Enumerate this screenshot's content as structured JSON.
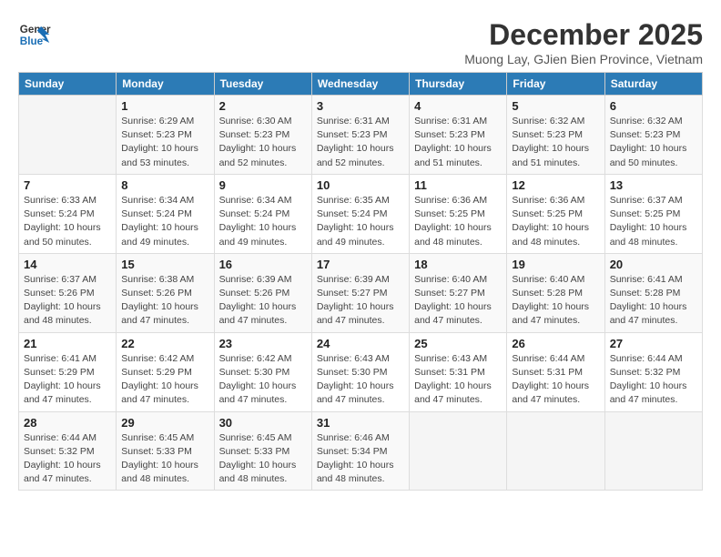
{
  "header": {
    "logo_line1": "General",
    "logo_line2": "Blue",
    "title": "December 2025",
    "subtitle": "Muong Lay, GJien Bien Province, Vietnam"
  },
  "days_of_week": [
    "Sunday",
    "Monday",
    "Tuesday",
    "Wednesday",
    "Thursday",
    "Friday",
    "Saturday"
  ],
  "weeks": [
    [
      {
        "day": "",
        "info": ""
      },
      {
        "day": "1",
        "info": "Sunrise: 6:29 AM\nSunset: 5:23 PM\nDaylight: 10 hours\nand 53 minutes."
      },
      {
        "day": "2",
        "info": "Sunrise: 6:30 AM\nSunset: 5:23 PM\nDaylight: 10 hours\nand 52 minutes."
      },
      {
        "day": "3",
        "info": "Sunrise: 6:31 AM\nSunset: 5:23 PM\nDaylight: 10 hours\nand 52 minutes."
      },
      {
        "day": "4",
        "info": "Sunrise: 6:31 AM\nSunset: 5:23 PM\nDaylight: 10 hours\nand 51 minutes."
      },
      {
        "day": "5",
        "info": "Sunrise: 6:32 AM\nSunset: 5:23 PM\nDaylight: 10 hours\nand 51 minutes."
      },
      {
        "day": "6",
        "info": "Sunrise: 6:32 AM\nSunset: 5:23 PM\nDaylight: 10 hours\nand 50 minutes."
      }
    ],
    [
      {
        "day": "7",
        "info": "Sunrise: 6:33 AM\nSunset: 5:24 PM\nDaylight: 10 hours\nand 50 minutes."
      },
      {
        "day": "8",
        "info": "Sunrise: 6:34 AM\nSunset: 5:24 PM\nDaylight: 10 hours\nand 49 minutes."
      },
      {
        "day": "9",
        "info": "Sunrise: 6:34 AM\nSunset: 5:24 PM\nDaylight: 10 hours\nand 49 minutes."
      },
      {
        "day": "10",
        "info": "Sunrise: 6:35 AM\nSunset: 5:24 PM\nDaylight: 10 hours\nand 49 minutes."
      },
      {
        "day": "11",
        "info": "Sunrise: 6:36 AM\nSunset: 5:25 PM\nDaylight: 10 hours\nand 48 minutes."
      },
      {
        "day": "12",
        "info": "Sunrise: 6:36 AM\nSunset: 5:25 PM\nDaylight: 10 hours\nand 48 minutes."
      },
      {
        "day": "13",
        "info": "Sunrise: 6:37 AM\nSunset: 5:25 PM\nDaylight: 10 hours\nand 48 minutes."
      }
    ],
    [
      {
        "day": "14",
        "info": "Sunrise: 6:37 AM\nSunset: 5:26 PM\nDaylight: 10 hours\nand 48 minutes."
      },
      {
        "day": "15",
        "info": "Sunrise: 6:38 AM\nSunset: 5:26 PM\nDaylight: 10 hours\nand 47 minutes."
      },
      {
        "day": "16",
        "info": "Sunrise: 6:39 AM\nSunset: 5:26 PM\nDaylight: 10 hours\nand 47 minutes."
      },
      {
        "day": "17",
        "info": "Sunrise: 6:39 AM\nSunset: 5:27 PM\nDaylight: 10 hours\nand 47 minutes."
      },
      {
        "day": "18",
        "info": "Sunrise: 6:40 AM\nSunset: 5:27 PM\nDaylight: 10 hours\nand 47 minutes."
      },
      {
        "day": "19",
        "info": "Sunrise: 6:40 AM\nSunset: 5:28 PM\nDaylight: 10 hours\nand 47 minutes."
      },
      {
        "day": "20",
        "info": "Sunrise: 6:41 AM\nSunset: 5:28 PM\nDaylight: 10 hours\nand 47 minutes."
      }
    ],
    [
      {
        "day": "21",
        "info": "Sunrise: 6:41 AM\nSunset: 5:29 PM\nDaylight: 10 hours\nand 47 minutes."
      },
      {
        "day": "22",
        "info": "Sunrise: 6:42 AM\nSunset: 5:29 PM\nDaylight: 10 hours\nand 47 minutes."
      },
      {
        "day": "23",
        "info": "Sunrise: 6:42 AM\nSunset: 5:30 PM\nDaylight: 10 hours\nand 47 minutes."
      },
      {
        "day": "24",
        "info": "Sunrise: 6:43 AM\nSunset: 5:30 PM\nDaylight: 10 hours\nand 47 minutes."
      },
      {
        "day": "25",
        "info": "Sunrise: 6:43 AM\nSunset: 5:31 PM\nDaylight: 10 hours\nand 47 minutes."
      },
      {
        "day": "26",
        "info": "Sunrise: 6:44 AM\nSunset: 5:31 PM\nDaylight: 10 hours\nand 47 minutes."
      },
      {
        "day": "27",
        "info": "Sunrise: 6:44 AM\nSunset: 5:32 PM\nDaylight: 10 hours\nand 47 minutes."
      }
    ],
    [
      {
        "day": "28",
        "info": "Sunrise: 6:44 AM\nSunset: 5:32 PM\nDaylight: 10 hours\nand 47 minutes."
      },
      {
        "day": "29",
        "info": "Sunrise: 6:45 AM\nSunset: 5:33 PM\nDaylight: 10 hours\nand 48 minutes."
      },
      {
        "day": "30",
        "info": "Sunrise: 6:45 AM\nSunset: 5:33 PM\nDaylight: 10 hours\nand 48 minutes."
      },
      {
        "day": "31",
        "info": "Sunrise: 6:46 AM\nSunset: 5:34 PM\nDaylight: 10 hours\nand 48 minutes."
      },
      {
        "day": "",
        "info": ""
      },
      {
        "day": "",
        "info": ""
      },
      {
        "day": "",
        "info": ""
      }
    ]
  ]
}
